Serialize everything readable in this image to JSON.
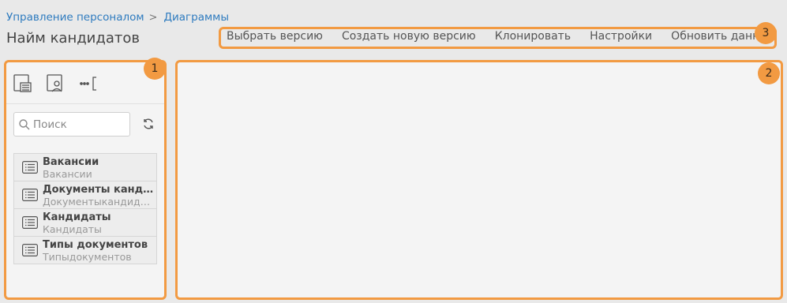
{
  "breadcrumb": {
    "items": [
      "Управление персоналом",
      "Диаграммы"
    ],
    "separator": ">"
  },
  "page_title": "Найм кандидатов",
  "toolbar": {
    "select_version": "Выбрать версию",
    "create_version": "Создать новую версию",
    "clone": "Клонировать",
    "settings": "Настройки",
    "refresh_data": "Обновить данные"
  },
  "badges": {
    "left": "1",
    "main": "2",
    "toolbar": "3"
  },
  "sidebar": {
    "search_placeholder": "Поиск",
    "tool_icons": [
      "list-view-icon",
      "user-view-icon",
      "more-icon"
    ],
    "items": [
      {
        "title": "Вакансии",
        "subtitle": "Вакансии"
      },
      {
        "title": "Документы кандидатов",
        "subtitle": "Документыкандидатов"
      },
      {
        "title": "Кандидаты",
        "subtitle": "Кандидаты"
      },
      {
        "title": "Типы документов",
        "subtitle": "Типыдокументов"
      }
    ]
  },
  "colors": {
    "highlight": "#f29a42",
    "link": "#2e7bbf"
  }
}
